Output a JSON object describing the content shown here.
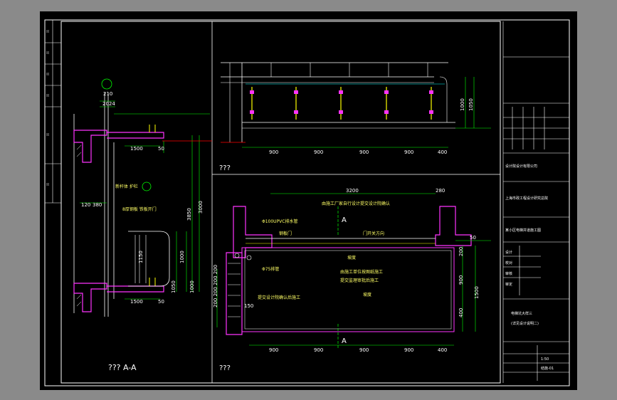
{
  "colors": {
    "background": "#000000",
    "frame": "#ffffff",
    "dimension": "#00ff00",
    "structure": "#ffffff",
    "section_fill": "#ff33ff",
    "railing": "#ffff00",
    "text": "#ffffff",
    "annotation": "#ffff66",
    "red_line": "#ff0000",
    "cyan": "#00ffff",
    "magenta": "#ff00ff"
  },
  "views": {
    "section_title": "??? A-A",
    "elevation_title": "???",
    "plan_title": "???"
  },
  "section_dims": {
    "d210": "210",
    "d2024": "2024",
    "d1500a": "1500",
    "d1500b": "1500",
    "d50a": "50",
    "d50b": "50",
    "d120": "120",
    "d380": "380",
    "d3850": "3850",
    "d3000": "3000",
    "d1000": "1000",
    "d1150": "1150",
    "d1050": "1050",
    "d1000b": "1000"
  },
  "section_notes": {
    "note1": "新杆体 护栏",
    "note2": "8厚钢板 铁板开门"
  },
  "elevation_dims": {
    "bottom": [
      "900",
      "900",
      "900",
      "900",
      "400"
    ],
    "h1000": "1000",
    "h1050": "1050"
  },
  "plan_dims": {
    "top": "3200",
    "d280": "280",
    "d50": "50",
    "d200": "200",
    "d900": "900",
    "d1500": "1500",
    "d400": "400",
    "d150": "150",
    "left_stack": "200 200 200 200",
    "bottom": [
      "900",
      "900",
      "900",
      "900",
      "400"
    ]
  },
  "plan_labels": {
    "section_a_top": "A",
    "section_a_bottom": "A",
    "pipe1": "Φ100UPVC排水管",
    "pipe2": "Φ75排管",
    "note_top": "由施工厂家自行设计提交设计院确认",
    "note_mid1": "由施工单位按图纸施工",
    "note_mid2": "提交监理审批后施工",
    "note_mid3": "提交设计院确认后施工",
    "door1": "钢板门",
    "door2": "门开关方向",
    "slope1": "坡度",
    "slope2": "坡度"
  },
  "title_block": {
    "firm_top": "设计院设计有限公司",
    "firm_mid": "上海市政工程设计研究总院",
    "project": "某小区电梯井道施工图",
    "drawing_name": "电梯坑大样三",
    "drawing_sub": "(详见设计说明二)",
    "row1": "设计",
    "row2": "校对",
    "row3": "审核",
    "row4": "审定",
    "scale": "1:50",
    "sheet_no": "结施-01"
  }
}
